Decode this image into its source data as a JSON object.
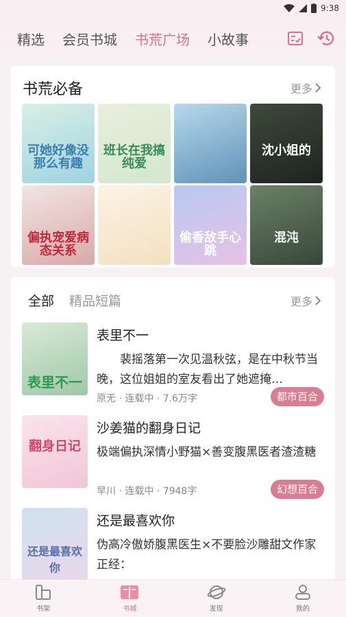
{
  "status_bar": {
    "time": "9:38"
  },
  "top_nav": {
    "tabs": [
      {
        "label": "精选",
        "active": false
      },
      {
        "label": "会员书城",
        "active": false
      },
      {
        "label": "书荒广场",
        "active": true
      },
      {
        "label": "小故事",
        "active": false
      }
    ],
    "icons": [
      "checklist-icon",
      "history-icon"
    ]
  },
  "essentials": {
    "title": "书荒必备",
    "more": "更多",
    "covers": [
      {
        "title": "可她好像没那么有趣",
        "colors": [
          "#d9efe6",
          "#9ed3e2"
        ],
        "text_color": "#3b7fb0"
      },
      {
        "title": "班长在我搞纯爱",
        "colors": [
          "#e9efdc",
          "#d3e7cf"
        ],
        "text_color": "#3a8c5a"
      },
      {
        "title": "",
        "colors": [
          "#b7d8ec",
          "#5f93b8"
        ],
        "text_color": "#ffffff"
      },
      {
        "title": "沈小姐的",
        "colors": [
          "#3d4a3a",
          "#1d2420"
        ],
        "text_color": "#ffffff"
      },
      {
        "title": "偏执宠爱病态关系",
        "colors": [
          "#f1e5e2",
          "#d9a9a9"
        ],
        "text_color": "#c2283c"
      },
      {
        "title": "",
        "colors": [
          "#fbf3e4",
          "#f3e0c0"
        ],
        "text_color": "#d36b3b"
      },
      {
        "title": "偷香敌手心跳",
        "colors": [
          "#b8c9f2",
          "#e7c1e6"
        ],
        "text_color": "#ffffff"
      },
      {
        "title": "混沌",
        "colors": [
          "#6c8166",
          "#37483a"
        ],
        "text_color": "#f2f2f2"
      }
    ]
  },
  "list_section": {
    "tabs": [
      {
        "label": "全部",
        "active": true
      },
      {
        "label": "精品短篇",
        "active": false
      }
    ],
    "more": "更多",
    "books": [
      {
        "title": "表里不一",
        "desc": "　　裴摇落第一次见温秋弦，是在中秋节当晚，这位姐姐的室友看出了她遮掩…",
        "meta": "原无 · 连载中 · 7.6万字",
        "tag": "都市百合",
        "colors": [
          "#d8ead6",
          "#9ec8a8"
        ],
        "cover_title": "表里不一",
        "cover_color": "#2f9a4e"
      },
      {
        "title": "沙姜猫的翻身日记",
        "desc": "极端偏执深情小野猫×善变腹黑医者渣渣糖",
        "meta": "早川 · 连载中 · 7948字",
        "tag": "幻想百合",
        "colors": [
          "#fbe3ec",
          "#f1c6d6"
        ],
        "cover_title": "翻身日记",
        "cover_color": "#d3476f"
      },
      {
        "title": "还是最喜欢你",
        "desc": "伪高冷傲娇腹黑医生×不要脸沙雕甜文作家正经：",
        "meta": "",
        "tag": "",
        "colors": [
          "#cfe2ef",
          "#e9d7ea"
        ],
        "cover_title": "还是最喜欢你",
        "cover_color": "#5a6fa8"
      }
    ]
  },
  "bottom_nav": {
    "items": [
      {
        "label": "书架",
        "icon": "bookshelf-icon",
        "active": false
      },
      {
        "label": "书城",
        "icon": "bookstore-icon",
        "active": true
      },
      {
        "label": "发现",
        "icon": "discover-icon",
        "active": false
      },
      {
        "label": "我的",
        "icon": "profile-icon",
        "active": false
      }
    ]
  },
  "colors": {
    "accent": "#d5738b",
    "tag_bg": "#db7d92"
  }
}
